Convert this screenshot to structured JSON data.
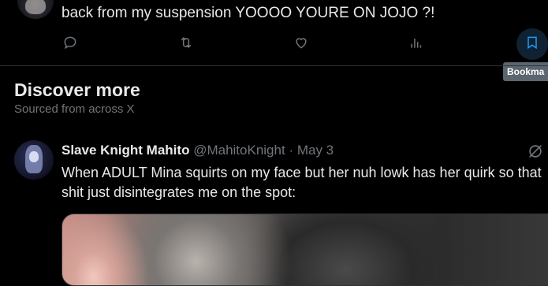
{
  "top_post": {
    "text": "back from my suspension YOOOO YOURE ON JOJO ?!",
    "actions": [
      {
        "name": "reply",
        "icon": "reply-icon"
      },
      {
        "name": "repost",
        "icon": "repost-icon"
      },
      {
        "name": "like",
        "icon": "heart-icon"
      },
      {
        "name": "views",
        "icon": "analytics-icon"
      },
      {
        "name": "bookmark",
        "icon": "bookmark-icon"
      }
    ],
    "tooltip": "Bookma"
  },
  "discover": {
    "title": "Discover more",
    "subtitle": "Sourced from across X"
  },
  "post": {
    "author_name": "Slave Knight Mahito",
    "handle": "@MahitoKnight",
    "separator": "·",
    "date": "May 3",
    "text": "When ADULT Mina squirts on my face but her nuh lowk has her quirk so that shit just disintegrates me on the spot:",
    "grok_icon": "grok-icon"
  },
  "colors": {
    "background": "#000000",
    "text": "#e7e9ea",
    "muted": "#71767b",
    "accent": "#1d9bf0",
    "divider": "#2f3336"
  }
}
